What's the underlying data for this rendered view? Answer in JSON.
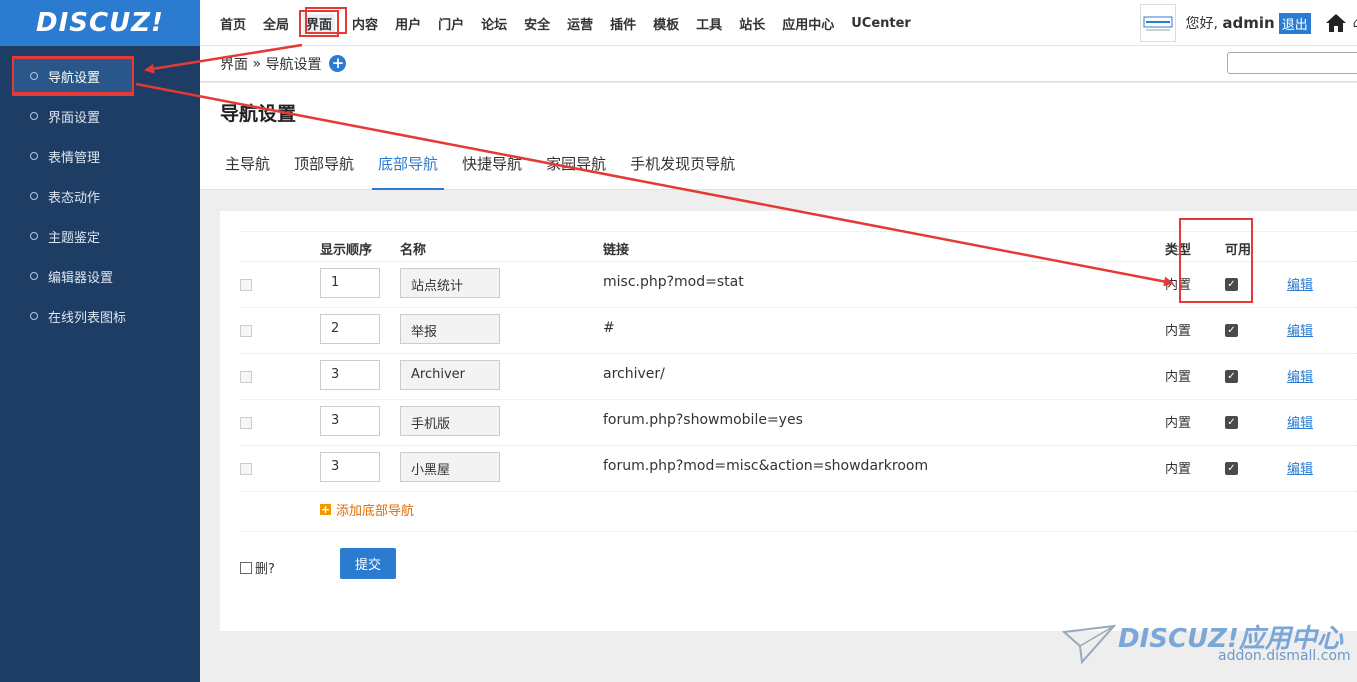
{
  "brand": {
    "logo_text": "DISCUZ!",
    "accent_color": "#2b7bd0"
  },
  "topnav": {
    "items": [
      "首页",
      "全局",
      "界面",
      "内容",
      "用户",
      "门户",
      "论坛",
      "安全",
      "运营",
      "插件",
      "模板",
      "工具",
      "站长",
      "应用中心",
      "UCenter"
    ],
    "active": "界面"
  },
  "user": {
    "greeting": "您好,",
    "name": "admin",
    "logout_label": "退出"
  },
  "sidebar": {
    "items": [
      "导航设置",
      "界面设置",
      "表情管理",
      "表态动作",
      "主题鉴定",
      "编辑器设置",
      "在线列表图标"
    ],
    "active": "导航设置"
  },
  "breadcrumb": {
    "section": "界面",
    "sep": "»",
    "page": "导航设置"
  },
  "page": {
    "title": "导航设置",
    "tabs": [
      "主导航",
      "顶部导航",
      "底部导航",
      "快捷导航",
      "家园导航",
      "手机发现页导航"
    ],
    "active_tab": "底部导航"
  },
  "table": {
    "headers": {
      "order": "显示顺序",
      "name": "名称",
      "link": "链接",
      "type": "类型",
      "available": "可用"
    },
    "rows": [
      {
        "order": "1",
        "name": "站点统计",
        "link": "misc.php?mod=stat",
        "type": "内置",
        "available": true,
        "edit": "编辑"
      },
      {
        "order": "2",
        "name": "举报",
        "link": "#",
        "type": "内置",
        "available": true,
        "edit": "编辑"
      },
      {
        "order": "3",
        "name": "Archiver",
        "link": "archiver/",
        "type": "内置",
        "available": true,
        "edit": "编辑"
      },
      {
        "order": "3",
        "name": "手机版",
        "link": "forum.php?showmobile=yes",
        "type": "内置",
        "available": true,
        "edit": "编辑"
      },
      {
        "order": "3",
        "name": "小黑屋",
        "link": "forum.php?mod=misc&action=showdarkroom",
        "type": "内置",
        "available": true,
        "edit": "编辑"
      }
    ],
    "add_label": "添加底部导航"
  },
  "footer": {
    "delete_label": "删?",
    "submit_label": "提交"
  },
  "watermark": {
    "logo": "DISCUZ!应用中心",
    "url": "addon.dismall.com"
  }
}
